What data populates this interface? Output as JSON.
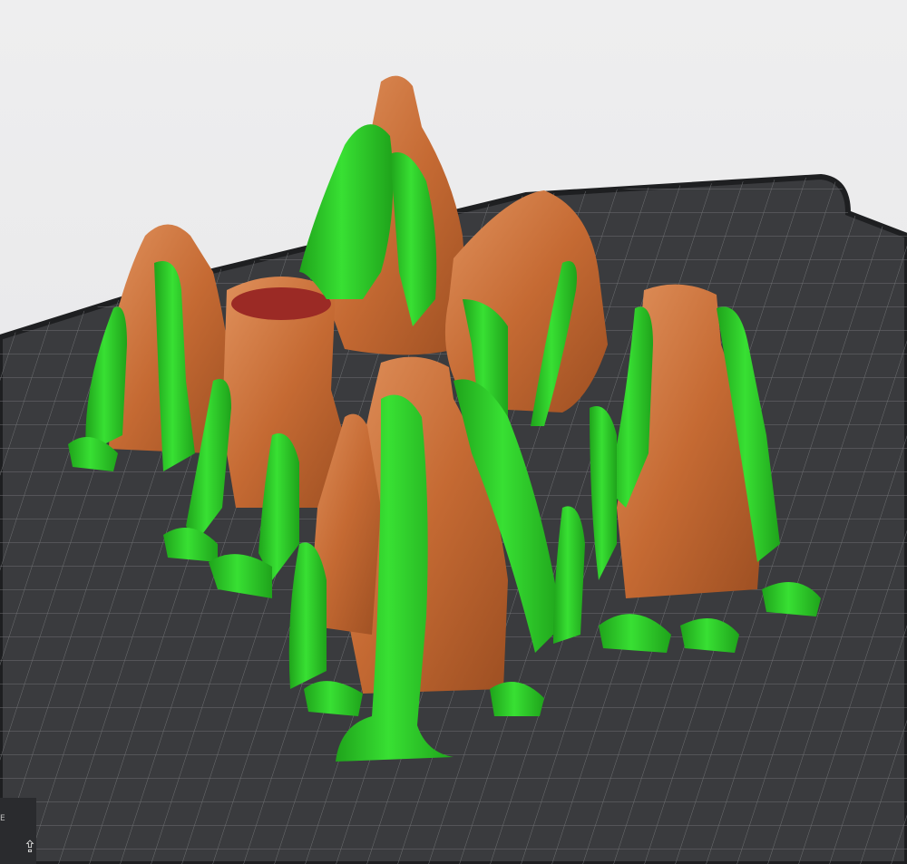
{
  "viewport": {
    "corner_icon": "home-view-icon",
    "corner_glyph": "⇪",
    "bed_mark": "E"
  },
  "colors": {
    "background": "#e9e9ea",
    "bed_surface": "#3a3b3e",
    "bed_grid": "#6f7073",
    "bed_border": "#1e1f21",
    "model": "#c56a33",
    "model_highlight": "#e0915c",
    "support": "#2fd12a",
    "support_shade": "#1fa31b"
  }
}
